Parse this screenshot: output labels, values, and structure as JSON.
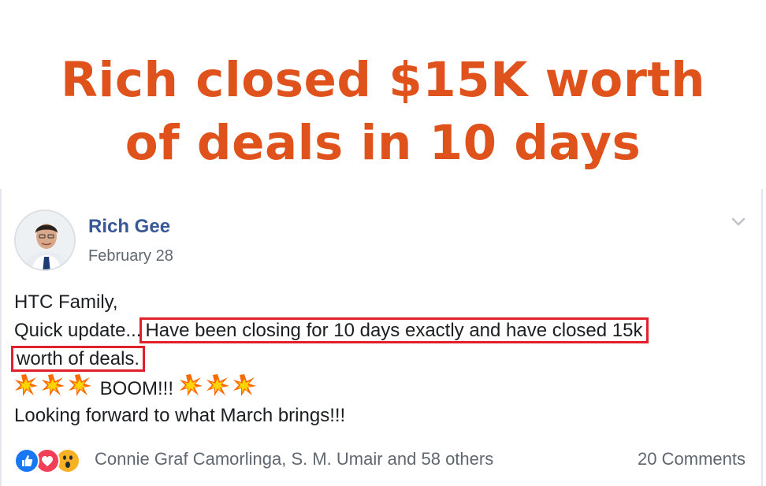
{
  "headline": {
    "line1": "Rich closed $15K worth",
    "line2": "of deals in 10 days",
    "color": "#e0521c"
  },
  "post": {
    "author": "Rich Gee",
    "date": "February 28",
    "greeting": "HTC Family,",
    "update_prefix": "Quick update...",
    "highlight_part1": "Have been closing for 10 days exactly and have closed 15k",
    "highlight_part2": "worth of deals.",
    "boom": "BOOM!!!",
    "closing": "Looking forward to what March brings!!!",
    "highlight_color": "#e0202a"
  },
  "reactions": {
    "icons": [
      "like-icon",
      "love-icon",
      "wow-icon"
    ],
    "names": "Connie Graf Camorlinga, S. M. Umair and 58 others",
    "comments": "20 Comments"
  },
  "colors": {
    "author_link": "#385898",
    "meta_text": "#606770",
    "body_text": "#1c1e21"
  }
}
